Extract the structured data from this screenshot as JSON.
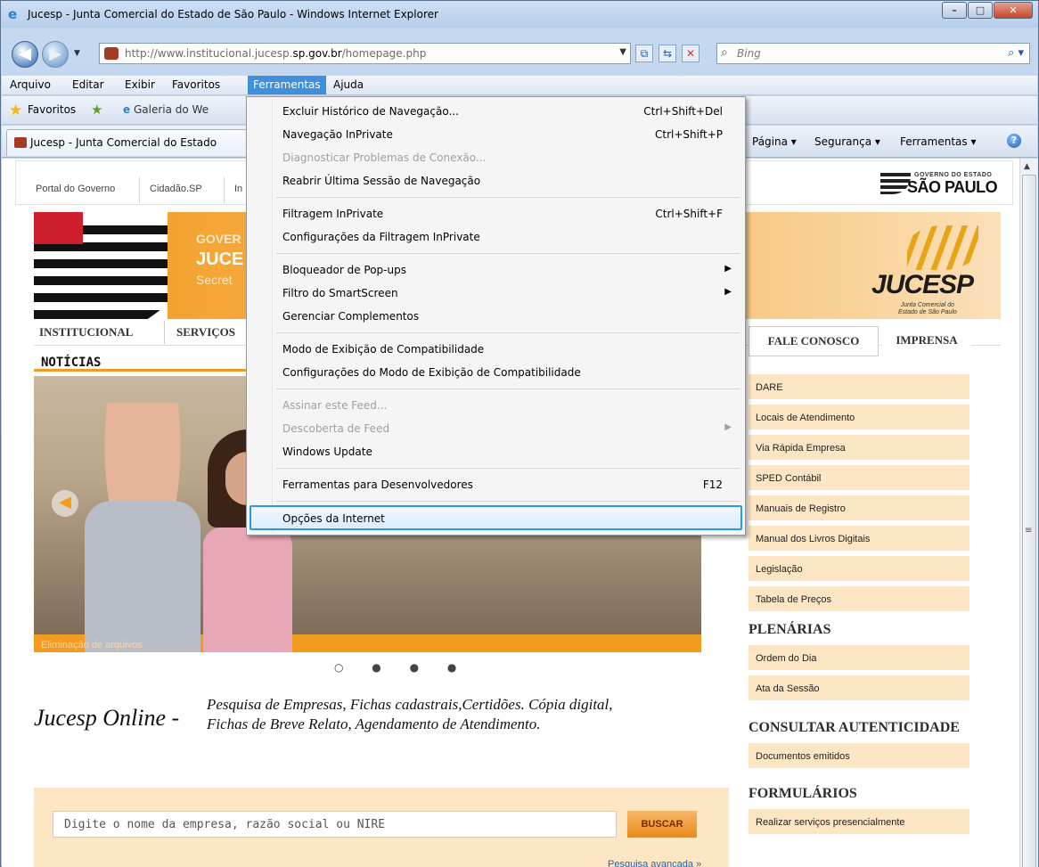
{
  "window": {
    "title": "Jucesp - Junta Comercial do Estado de São Paulo - Windows Internet Explorer",
    "min_icon": "minimize-icon",
    "max_icon": "maximize-icon",
    "close_icon": "close-icon"
  },
  "address": {
    "url_prefix": "http://www.institucional.jucesp.",
    "url_domain": "sp.gov.br",
    "url_suffix": "/homepage.php"
  },
  "search": {
    "placeholder": "Bing"
  },
  "menubar": [
    "Arquivo",
    "Editar",
    "Exibir",
    "Favoritos",
    "Ferramentas",
    "Ajuda"
  ],
  "favorites": {
    "label": "Favoritos",
    "gallery": "Galeria do We"
  },
  "tab": {
    "title": "Jucesp - Junta Comercial do Estado"
  },
  "commandbar": {
    "page": "Página ▾",
    "security": "Segurança ▾",
    "tools": "Ferramentas ▾"
  },
  "govbar": {
    "links": [
      "Portal do Governo",
      "Cidadão.SP",
      "In"
    ],
    "logo_top": "GOVERNO DO ESTADO",
    "logo_main": "SÃO PAULO"
  },
  "header": {
    "line1": "GOVER",
    "line2": "JUCE",
    "line3": "Secret",
    "logo": "JUCESP",
    "logo_sub1": "Junta Comercial do",
    "logo_sub2": "Estado de São Paulo"
  },
  "mainnav": [
    "INSTITUCIONAL",
    "SERVIÇOS"
  ],
  "right_top": [
    "FALE CONOSCO",
    "IMPRENSA"
  ],
  "news": {
    "heading": "NOTÍCIAS",
    "caption": "Eliminação de arquivos",
    "dots": "○ ● ● ●"
  },
  "online": {
    "title": "Jucesp Online -",
    "text1": "Pesquisa de Empresas, Fichas cadastrais,Certidões. Cópia digital,",
    "text2": "Fichas de Breve Relato, Agendamento de Atendimento."
  },
  "searchbox": {
    "placeholder": "Digite o nome da empresa, razão social ou NIRE",
    "button": "BUSCAR",
    "advanced": "Pesquisa avançada »"
  },
  "right_links": [
    "DARE",
    "Locais de Atendimento",
    "Via Rápida Empresa",
    "SPED Contábil",
    "Manuais de Registro",
    "Manual dos Livros Digitais",
    "Legislação",
    "Tabela de Preços"
  ],
  "plenarias": {
    "heading": "PLENÁRIAS",
    "links": [
      "Ordem do Dia",
      "Ata da Sessão"
    ]
  },
  "autenticidade": {
    "heading": "CONSULTAR AUTENTICIDADE",
    "links": [
      "Documentos emitidos"
    ]
  },
  "formularios": {
    "heading": "FORMULÁRIOS",
    "links": [
      "Realizar serviços presencialmente"
    ]
  },
  "tools_menu": [
    {
      "label": "Excluir Histórico de Navegação...",
      "shortcut": "Ctrl+Shift+Del"
    },
    {
      "label": "Navegação InPrivate",
      "shortcut": "Ctrl+Shift+P"
    },
    {
      "label": "Diagnosticar Problemas de Conexão...",
      "shortcut": ""
    },
    {
      "label": "Reabrir Última Sessão de Navegação",
      "shortcut": ""
    },
    {
      "label": "Filtragem InPrivate",
      "shortcut": "Ctrl+Shift+F"
    },
    {
      "label": "Configurações da Filtragem InPrivate",
      "shortcut": ""
    },
    {
      "label": "Bloqueador de Pop-ups",
      "shortcut": ""
    },
    {
      "label": "Filtro do SmartScreen",
      "shortcut": ""
    },
    {
      "label": "Gerenciar Complementos",
      "shortcut": ""
    },
    {
      "label": "Modo de Exibição de Compatibilidade",
      "shortcut": ""
    },
    {
      "label": "Configurações do Modo de Exibição de Compatibilidade",
      "shortcut": ""
    },
    {
      "label": "Assinar este Feed...",
      "shortcut": ""
    },
    {
      "label": "Descoberta de Feed",
      "shortcut": ""
    },
    {
      "label": "Windows Update",
      "shortcut": ""
    },
    {
      "label": "Ferramentas para Desenvolvedores",
      "shortcut": "F12"
    },
    {
      "label": "Opções da Internet",
      "shortcut": ""
    }
  ]
}
